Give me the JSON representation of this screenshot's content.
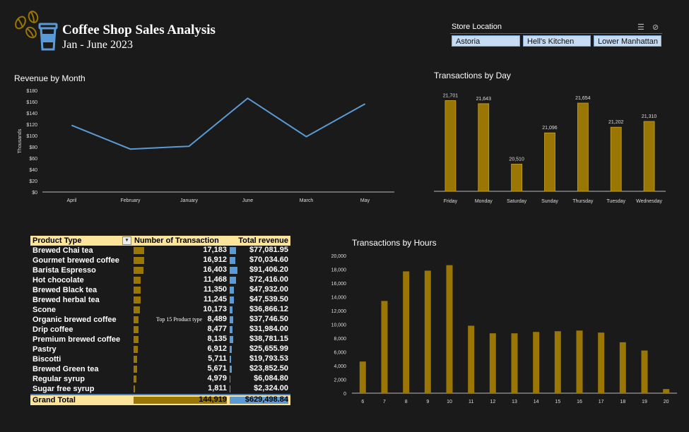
{
  "header": {
    "title": "Coffee Shop Sales Analysis",
    "subtitle": "Jan - June 2023"
  },
  "slicer": {
    "label": "Store Location",
    "items": [
      "Astoria",
      "Hell's Kitchen",
      "Lower Manhattan"
    ]
  },
  "colors": {
    "gold": "#9a7605",
    "line": "#5b9bd5",
    "background": "#1a1a1a",
    "header_fill": "#fde49b"
  },
  "table": {
    "headers": [
      "Product Type",
      "Number of Transaction",
      "Total revenue"
    ],
    "rows": [
      {
        "type": "Brewed Chai tea",
        "transactions": "17,183",
        "revenue": "$77,081.95",
        "tx": 17183,
        "rev": 77081.95
      },
      {
        "type": "Gourmet brewed coffee",
        "transactions": "16,912",
        "revenue": "$70,034.60",
        "tx": 16912,
        "rev": 70034.6
      },
      {
        "type": "Barista Espresso",
        "transactions": "16,403",
        "revenue": "$91,406.20",
        "tx": 16403,
        "rev": 91406.2
      },
      {
        "type": "Hot chocolate",
        "transactions": "11,468",
        "revenue": "$72,416.00",
        "tx": 11468,
        "rev": 72416.0
      },
      {
        "type": "Brewed Black tea",
        "transactions": "11,350",
        "revenue": "$47,932.00",
        "tx": 11350,
        "rev": 47932.0
      },
      {
        "type": "Brewed herbal tea",
        "transactions": "11,245",
        "revenue": "$47,539.50",
        "tx": 11245,
        "rev": 47539.5
      },
      {
        "type": "Scone",
        "transactions": "10,173",
        "revenue": "$36,866.12",
        "tx": 10173,
        "rev": 36866.12
      },
      {
        "type": "Organic brewed coffee",
        "transactions": "8,489",
        "revenue": "$37,746.50",
        "tx": 8489,
        "rev": 37746.5
      },
      {
        "type": "Drip coffee",
        "transactions": "8,477",
        "revenue": "$31,984.00",
        "tx": 8477,
        "rev": 31984.0
      },
      {
        "type": "Premium brewed coffee",
        "transactions": "8,135",
        "revenue": "$38,781.15",
        "tx": 8135,
        "rev": 38781.15
      },
      {
        "type": "Pastry",
        "transactions": "6,912",
        "revenue": "$25,655.99",
        "tx": 6912,
        "rev": 25655.99
      },
      {
        "type": "Biscotti",
        "transactions": "5,711",
        "revenue": "$19,793.53",
        "tx": 5711,
        "rev": 19793.53
      },
      {
        "type": "Brewed Green tea",
        "transactions": "5,671",
        "revenue": "$23,852.50",
        "tx": 5671,
        "rev": 23852.5
      },
      {
        "type": "Regular syrup",
        "transactions": "4,979",
        "revenue": "$6,084.80",
        "tx": 4979,
        "rev": 6084.8
      },
      {
        "type": "Sugar free syrup",
        "transactions": "1,811",
        "revenue": "$2,324.00",
        "tx": 1811,
        "rev": 2324.0
      }
    ],
    "total": {
      "label": "Grand Total",
      "transactions": "144,919",
      "revenue": "$629,498.84"
    },
    "note": "Top 15 Product type"
  },
  "chart_data": [
    {
      "type": "line",
      "title": "Revenue by Month",
      "ylabel": "Thousands",
      "categories": [
        "April",
        "February",
        "January",
        "June",
        "March",
        "May"
      ],
      "values": [
        118,
        76,
        81,
        166,
        98,
        156
      ],
      "ylim": [
        0,
        180
      ],
      "yticks": [
        "$0",
        "$20",
        "$40",
        "$60",
        "$80",
        "$100",
        "$120",
        "$140",
        "$160",
        "$180"
      ]
    },
    {
      "type": "bar",
      "title": "Transactions by Day",
      "categories": [
        "Friday",
        "Monday",
        "Saturday",
        "Sunday",
        "Thursday",
        "Tuesday",
        "Wednesday"
      ],
      "values": [
        21701,
        21643,
        20510,
        21096,
        21654,
        21202,
        21310
      ],
      "labels": [
        "21,701",
        "21,643",
        "20,510",
        "21,096",
        "21,654",
        "21,202",
        "21,310"
      ],
      "ylim": [
        20000,
        21800
      ]
    },
    {
      "type": "bar",
      "title": "Transactions by Hours",
      "categories": [
        "6",
        "7",
        "8",
        "9",
        "10",
        "11",
        "12",
        "13",
        "14",
        "15",
        "16",
        "17",
        "18",
        "19",
        "20"
      ],
      "values": [
        4600,
        13400,
        17700,
        17800,
        18600,
        9800,
        8700,
        8700,
        8900,
        9000,
        9100,
        8800,
        7400,
        6200,
        600
      ],
      "ylim": [
        0,
        20000
      ],
      "yticks": [
        "0",
        "2,000",
        "4,000",
        "6,000",
        "8,000",
        "10,000",
        "12,000",
        "14,000",
        "16,000",
        "18,000",
        "20,000"
      ]
    }
  ]
}
